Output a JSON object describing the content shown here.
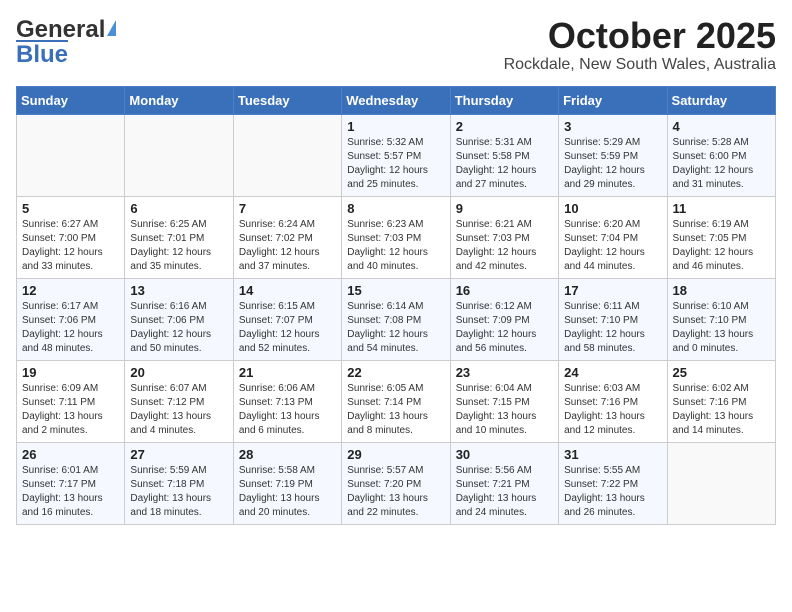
{
  "header": {
    "logo_general": "General",
    "logo_blue": "Blue",
    "month_year": "October 2025",
    "location": "Rockdale, New South Wales, Australia"
  },
  "weekdays": [
    "Sunday",
    "Monday",
    "Tuesday",
    "Wednesday",
    "Thursday",
    "Friday",
    "Saturday"
  ],
  "weeks": [
    [
      {
        "day": "",
        "detail": ""
      },
      {
        "day": "",
        "detail": ""
      },
      {
        "day": "",
        "detail": ""
      },
      {
        "day": "1",
        "detail": "Sunrise: 5:32 AM\nSunset: 5:57 PM\nDaylight: 12 hours\nand 25 minutes."
      },
      {
        "day": "2",
        "detail": "Sunrise: 5:31 AM\nSunset: 5:58 PM\nDaylight: 12 hours\nand 27 minutes."
      },
      {
        "day": "3",
        "detail": "Sunrise: 5:29 AM\nSunset: 5:59 PM\nDaylight: 12 hours\nand 29 minutes."
      },
      {
        "day": "4",
        "detail": "Sunrise: 5:28 AM\nSunset: 6:00 PM\nDaylight: 12 hours\nand 31 minutes."
      }
    ],
    [
      {
        "day": "5",
        "detail": "Sunrise: 6:27 AM\nSunset: 7:00 PM\nDaylight: 12 hours\nand 33 minutes."
      },
      {
        "day": "6",
        "detail": "Sunrise: 6:25 AM\nSunset: 7:01 PM\nDaylight: 12 hours\nand 35 minutes."
      },
      {
        "day": "7",
        "detail": "Sunrise: 6:24 AM\nSunset: 7:02 PM\nDaylight: 12 hours\nand 37 minutes."
      },
      {
        "day": "8",
        "detail": "Sunrise: 6:23 AM\nSunset: 7:03 PM\nDaylight: 12 hours\nand 40 minutes."
      },
      {
        "day": "9",
        "detail": "Sunrise: 6:21 AM\nSunset: 7:03 PM\nDaylight: 12 hours\nand 42 minutes."
      },
      {
        "day": "10",
        "detail": "Sunrise: 6:20 AM\nSunset: 7:04 PM\nDaylight: 12 hours\nand 44 minutes."
      },
      {
        "day": "11",
        "detail": "Sunrise: 6:19 AM\nSunset: 7:05 PM\nDaylight: 12 hours\nand 46 minutes."
      }
    ],
    [
      {
        "day": "12",
        "detail": "Sunrise: 6:17 AM\nSunset: 7:06 PM\nDaylight: 12 hours\nand 48 minutes."
      },
      {
        "day": "13",
        "detail": "Sunrise: 6:16 AM\nSunset: 7:06 PM\nDaylight: 12 hours\nand 50 minutes."
      },
      {
        "day": "14",
        "detail": "Sunrise: 6:15 AM\nSunset: 7:07 PM\nDaylight: 12 hours\nand 52 minutes."
      },
      {
        "day": "15",
        "detail": "Sunrise: 6:14 AM\nSunset: 7:08 PM\nDaylight: 12 hours\nand 54 minutes."
      },
      {
        "day": "16",
        "detail": "Sunrise: 6:12 AM\nSunset: 7:09 PM\nDaylight: 12 hours\nand 56 minutes."
      },
      {
        "day": "17",
        "detail": "Sunrise: 6:11 AM\nSunset: 7:10 PM\nDaylight: 12 hours\nand 58 minutes."
      },
      {
        "day": "18",
        "detail": "Sunrise: 6:10 AM\nSunset: 7:10 PM\nDaylight: 13 hours\nand 0 minutes."
      }
    ],
    [
      {
        "day": "19",
        "detail": "Sunrise: 6:09 AM\nSunset: 7:11 PM\nDaylight: 13 hours\nand 2 minutes."
      },
      {
        "day": "20",
        "detail": "Sunrise: 6:07 AM\nSunset: 7:12 PM\nDaylight: 13 hours\nand 4 minutes."
      },
      {
        "day": "21",
        "detail": "Sunrise: 6:06 AM\nSunset: 7:13 PM\nDaylight: 13 hours\nand 6 minutes."
      },
      {
        "day": "22",
        "detail": "Sunrise: 6:05 AM\nSunset: 7:14 PM\nDaylight: 13 hours\nand 8 minutes."
      },
      {
        "day": "23",
        "detail": "Sunrise: 6:04 AM\nSunset: 7:15 PM\nDaylight: 13 hours\nand 10 minutes."
      },
      {
        "day": "24",
        "detail": "Sunrise: 6:03 AM\nSunset: 7:16 PM\nDaylight: 13 hours\nand 12 minutes."
      },
      {
        "day": "25",
        "detail": "Sunrise: 6:02 AM\nSunset: 7:16 PM\nDaylight: 13 hours\nand 14 minutes."
      }
    ],
    [
      {
        "day": "26",
        "detail": "Sunrise: 6:01 AM\nSunset: 7:17 PM\nDaylight: 13 hours\nand 16 minutes."
      },
      {
        "day": "27",
        "detail": "Sunrise: 5:59 AM\nSunset: 7:18 PM\nDaylight: 13 hours\nand 18 minutes."
      },
      {
        "day": "28",
        "detail": "Sunrise: 5:58 AM\nSunset: 7:19 PM\nDaylight: 13 hours\nand 20 minutes."
      },
      {
        "day": "29",
        "detail": "Sunrise: 5:57 AM\nSunset: 7:20 PM\nDaylight: 13 hours\nand 22 minutes."
      },
      {
        "day": "30",
        "detail": "Sunrise: 5:56 AM\nSunset: 7:21 PM\nDaylight: 13 hours\nand 24 minutes."
      },
      {
        "day": "31",
        "detail": "Sunrise: 5:55 AM\nSunset: 7:22 PM\nDaylight: 13 hours\nand 26 minutes."
      },
      {
        "day": "",
        "detail": ""
      }
    ]
  ]
}
